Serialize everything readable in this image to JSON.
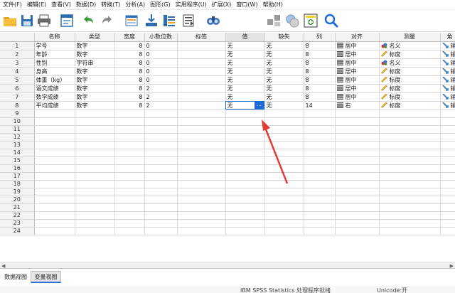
{
  "menu": [
    "文件(F)",
    "编辑(E)",
    "查看(V)",
    "数据(D)",
    "转换(T)",
    "分析(A)",
    "图形(G)",
    "实用程序(U)",
    "扩展(X)",
    "窗口(W)",
    "帮助(H)"
  ],
  "toolbar": {
    "icons": [
      "open-icon",
      "save-icon",
      "print-icon",
      "dialog-recall-icon",
      "undo-icon",
      "redo-icon",
      "goto-case-icon",
      "goto-variable-icon",
      "variables-icon",
      "run-script-icon",
      "find-icon",
      "split-file-icon",
      "weight-cases-icon",
      "select-cases-icon",
      "value-labels-icon",
      "search-icon"
    ]
  },
  "columns": [
    "",
    "名称",
    "类型",
    "宽度",
    "小数位数",
    "标签",
    "值",
    "缺失",
    "列",
    "对齐",
    "测量",
    "角"
  ],
  "rows": [
    {
      "n": "1",
      "name": "学号",
      "type": "数字",
      "width": "8",
      "dec": "0",
      "label": "",
      "values": "无",
      "missing": "无",
      "cols": "8",
      "align": "居中",
      "measure": "名义",
      "role": "输"
    },
    {
      "n": "2",
      "name": "年龄",
      "type": "数字",
      "width": "8",
      "dec": "0",
      "label": "",
      "values": "无",
      "missing": "无",
      "cols": "8",
      "align": "居中",
      "measure": "标度",
      "role": "输"
    },
    {
      "n": "3",
      "name": "性别",
      "type": "字符串",
      "width": "8",
      "dec": "0",
      "label": "",
      "values": "无",
      "missing": "无",
      "cols": "8",
      "align": "居中",
      "measure": "名义",
      "role": "输"
    },
    {
      "n": "4",
      "name": "身高",
      "type": "数字",
      "width": "8",
      "dec": "0",
      "label": "",
      "values": "无",
      "missing": "无",
      "cols": "8",
      "align": "居中",
      "measure": "标度",
      "role": "输"
    },
    {
      "n": "5",
      "name": "体重（kg）",
      "type": "数字",
      "width": "8",
      "dec": "0",
      "label": "",
      "values": "无",
      "missing": "无",
      "cols": "8",
      "align": "居中",
      "measure": "标度",
      "role": "输"
    },
    {
      "n": "6",
      "name": "语文成绩",
      "type": "数字",
      "width": "8",
      "dec": "2",
      "label": "",
      "values": "无",
      "missing": "无",
      "cols": "8",
      "align": "居中",
      "measure": "标度",
      "role": "输"
    },
    {
      "n": "7",
      "name": "数学成绩",
      "type": "数字",
      "width": "8",
      "dec": "2",
      "label": "",
      "values": "无",
      "missing": "无",
      "cols": "8",
      "align": "居中",
      "measure": "标度",
      "role": "输"
    },
    {
      "n": "8",
      "name": "平均成绩",
      "type": "数字",
      "width": "8",
      "dec": "2",
      "label": "",
      "values": "无",
      "missing": "无",
      "cols": "14",
      "align": "右",
      "measure": "标度",
      "role": "输"
    }
  ],
  "empty_row_numbers": [
    "9",
    "10",
    "11",
    "12",
    "13",
    "14",
    "15",
    "16",
    "17",
    "18",
    "19",
    "20",
    "21",
    "22",
    "23",
    "24"
  ],
  "active_cell_button": "...",
  "tabs": {
    "data_view": "数据视图",
    "variable_view": "变量视图"
  },
  "status": {
    "text": "IBM SPSS Statistics 处理程序就绪",
    "unicode": "Unicode:开"
  },
  "colors": {
    "accent": "#1e6ad6",
    "arrow": "#e53935",
    "tab_underline": "#2d6fd1"
  }
}
